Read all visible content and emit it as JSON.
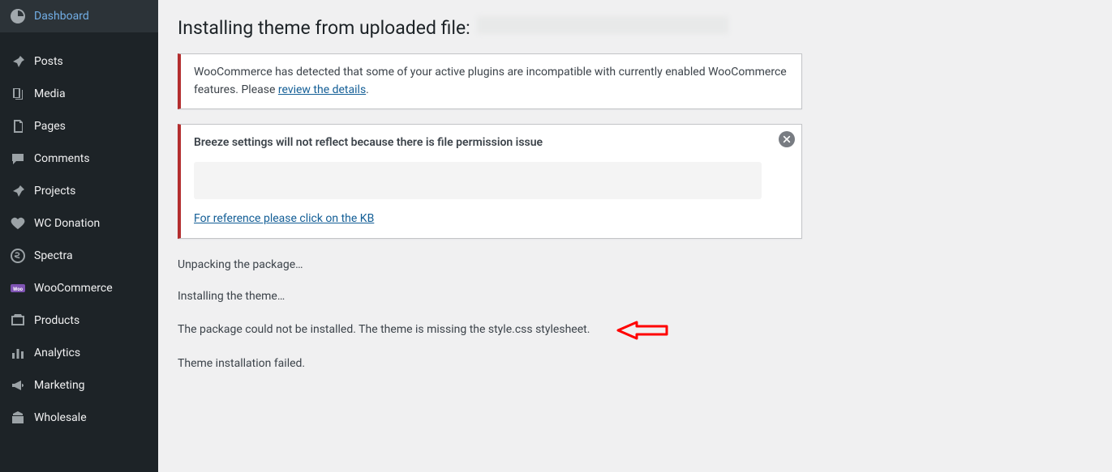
{
  "sidebar": {
    "items": [
      {
        "label": "Dashboard",
        "icon": "dashboard-icon"
      },
      {
        "label": "Posts",
        "icon": "pin-icon"
      },
      {
        "label": "Media",
        "icon": "media-icon"
      },
      {
        "label": "Pages",
        "icon": "pages-icon"
      },
      {
        "label": "Comments",
        "icon": "comments-icon"
      },
      {
        "label": "Projects",
        "icon": "pin-icon"
      },
      {
        "label": "WC Donation",
        "icon": "heart-icon"
      },
      {
        "label": "Spectra",
        "icon": "spectra-icon"
      },
      {
        "label": "WooCommerce",
        "icon": "woo-icon"
      },
      {
        "label": "Products",
        "icon": "products-icon"
      },
      {
        "label": "Analytics",
        "icon": "analytics-icon"
      },
      {
        "label": "Marketing",
        "icon": "marketing-icon"
      },
      {
        "label": "Wholesale",
        "icon": "wholesale-icon"
      }
    ]
  },
  "main": {
    "title_prefix": "Installing theme from uploaded file:",
    "notices": {
      "woo": {
        "text_before": "WooCommerce has detected that some of your active plugins are incompatible with currently enabled WooCommerce features. Please ",
        "link_text": "review the details",
        "text_after": "."
      },
      "breeze": {
        "heading": "Breeze settings will not reflect because there is file permission issue",
        "link_text": "For reference please click on the KB"
      }
    },
    "status": {
      "unpacking": "Unpacking the package…",
      "installing": "Installing the theme…",
      "error": "The package could not be installed. The theme is missing the style.css stylesheet.",
      "failed": "Theme installation failed."
    }
  }
}
